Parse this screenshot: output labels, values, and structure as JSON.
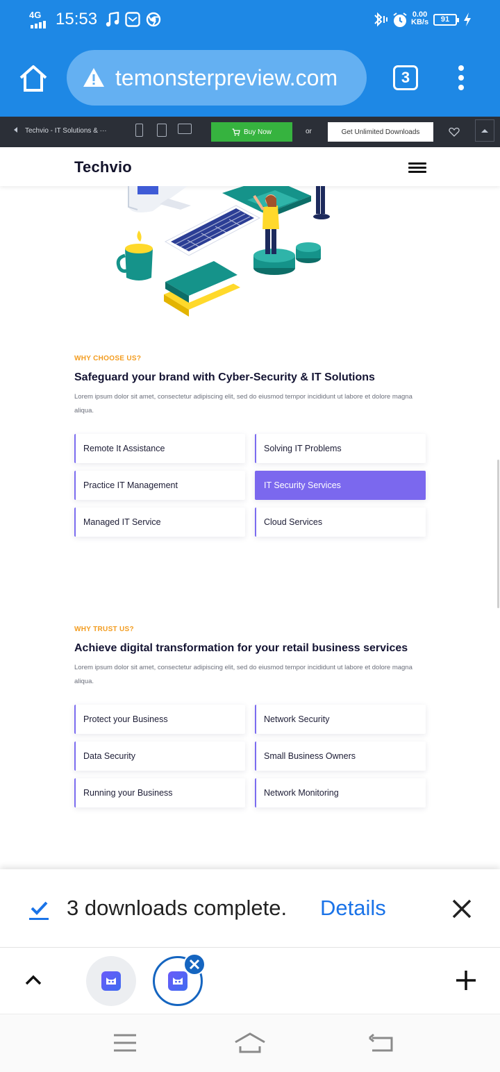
{
  "status_bar": {
    "network": "4G",
    "time": "15:53",
    "speed_value": "0.00",
    "speed_unit": "KB/s",
    "battery": "91"
  },
  "browser": {
    "url": "temonsterpreview.com",
    "tab_count": "3"
  },
  "preview_bar": {
    "page_title": "Techvio - IT Solutions & ···",
    "buy_now": "Buy Now",
    "or": "or",
    "unlimited": "Get Unlimited Downloads",
    "accent": "#36b33f"
  },
  "site": {
    "logo": "Techvio"
  },
  "section1": {
    "kicker": "WHY CHOOSE US?",
    "title": "Safeguard your brand with Cyber-Security & IT Solutions",
    "text": "Lorem ipsum dolor sit amet, consectetur adipiscing elit, sed do eiusmod tempor incididunt ut labore et dolore magna aliqua.",
    "items": [
      "Remote It Assistance",
      "Solving IT Problems",
      "Practice IT Management",
      "IT Security Services",
      "Managed IT Service",
      "Cloud Services"
    ],
    "active_item": "IT Security Services"
  },
  "section2": {
    "kicker": "WHY TRUST US?",
    "title": "Achieve digital transformation for your retail business services",
    "text": "Lorem ipsum dolor sit amet, consectetur adipiscing elit, sed do eiusmod tempor incididunt ut labore et dolore magna aliqua.",
    "items": [
      "Protect your Business",
      "Network Security",
      "Data Security",
      "Small Business Owners",
      "Running your Business",
      "Network Monitoring"
    ]
  },
  "download": {
    "message": "3 downloads complete.",
    "details": "Details"
  },
  "colors": {
    "browser_blue": "#1e88e5",
    "kicker_orange": "#f39c1f",
    "card_accent": "#7b68ee",
    "link_blue": "#1a73e8"
  }
}
